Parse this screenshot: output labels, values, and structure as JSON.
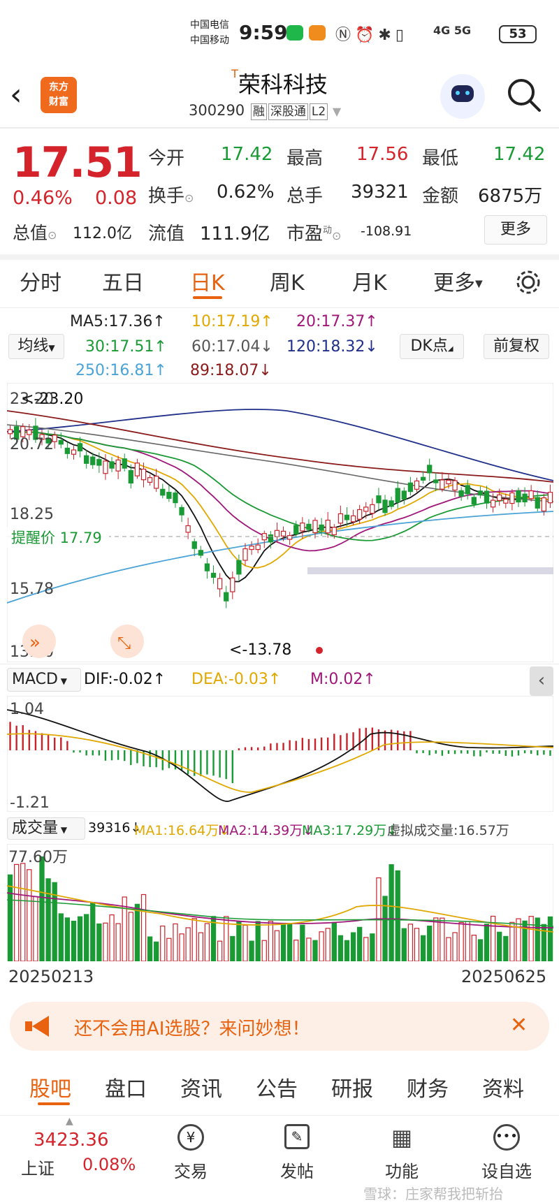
{
  "status_bar": {
    "carrier1": "中国电信",
    "carrier2": "中国移动",
    "time": "9:59",
    "signal": "4G 5G",
    "battery": "53"
  },
  "header": {
    "logo_line1": "东方",
    "logo_line2": "财富",
    "title": "荣科科技",
    "title_mark": "T",
    "code": "300290",
    "tags": [
      "融",
      "深股通",
      "L2"
    ]
  },
  "quote": {
    "price": "17.51",
    "change_pct": "0.46%",
    "change": "0.08",
    "open_label": "今开",
    "open": "17.42",
    "high_label": "最高",
    "high": "17.56",
    "low_label": "最低",
    "low": "17.42",
    "turnover_label": "换手",
    "turnover": "0.62%",
    "volume_label": "总手",
    "volume": "39321",
    "amount_label": "金额",
    "amount": "6875万",
    "mcap_label": "总值",
    "mcap": "112.0亿",
    "float_label": "流值",
    "float": "111.9亿",
    "pe_label": "市盈",
    "pe_sup": "动",
    "pe": "-108.91",
    "more": "更多"
  },
  "tabs": [
    "分时",
    "五日",
    "日K",
    "周K",
    "月K",
    "更多"
  ],
  "active_tab": "日K",
  "ma_legend": {
    "ma5": "MA5:17.36↑",
    "ma10": "10:17.19↑",
    "ma20": "20:17.37↑",
    "ma30": "30:17.51↑",
    "ma60": "60:17.04↓",
    "ma120": "120:18.32↓",
    "ma250": "250:16.81↑",
    "ma89": "89:18.07↓",
    "mode": "均线",
    "dk": "DK点",
    "adjust": "前复权"
  },
  "kline": {
    "y_labels": [
      "23.20",
      "20.72",
      "18.25",
      "15.78",
      "13.30"
    ],
    "high_mark": "<-23.20",
    "low_mark": "<-13.78",
    "alert_label": "提醒价 17.79"
  },
  "macd": {
    "name": "MACD",
    "dif": "DIF:-0.02↑",
    "dea": "DEA:-0.03↑",
    "m": "M:0.02↑",
    "y_top": "1.04",
    "y_bottom": "-1.21"
  },
  "volume": {
    "name": "成交量",
    "value": "39316↓",
    "ma1": "MA1:16.64万↓",
    "ma2": "MA2:14.39万↓",
    "ma3": "MA3:17.29万↓",
    "virtual": "虚拟成交量:16.57万",
    "y_top": "77.60万"
  },
  "dates": {
    "start": "20250213",
    "end": "20250625"
  },
  "banner": {
    "text": "还不会用AI选股？来问妙想！"
  },
  "bottom_tabs": [
    "股吧",
    "盘口",
    "资讯",
    "公告",
    "研报",
    "财务",
    "资料"
  ],
  "bottom_nav": {
    "index_value": "3423.36",
    "index_name": "上证",
    "index_change": "0.08%",
    "items": [
      "交易",
      "发帖",
      "功能",
      "设自选"
    ]
  },
  "watermark": "雪球：庄家帮我把斩抬",
  "colors": {
    "up": "#d4232b",
    "down": "#1a9a35",
    "accent": "#e8620f"
  }
}
